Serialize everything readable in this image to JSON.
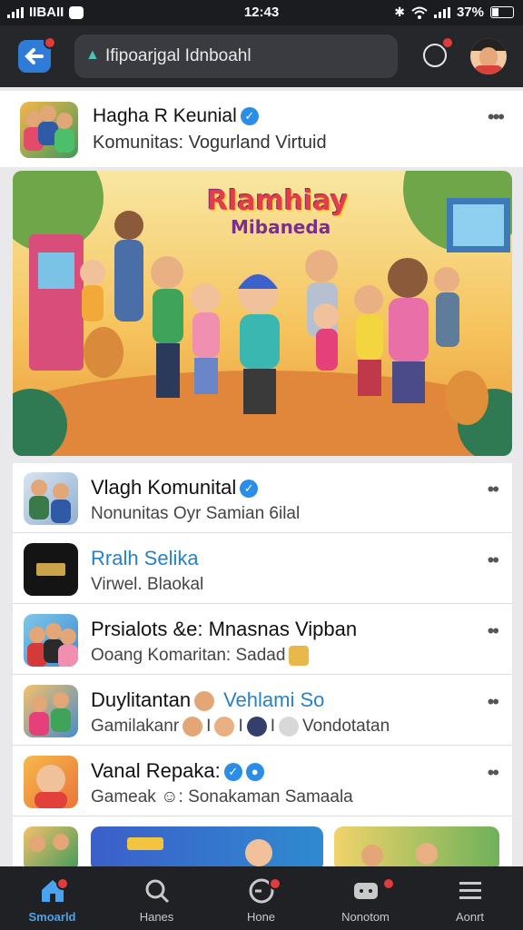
{
  "status_bar": {
    "left_text": "IIBAII",
    "time": "12:43",
    "battery": "37%"
  },
  "top_bar": {
    "search_placeholder": "Ifipoarjgal Idnboahl"
  },
  "featured": {
    "title": "Hagha R Keunial",
    "subtitle": "Komunitas: Vogurland Virtuid"
  },
  "banner": {
    "title": "Rlamhiay",
    "subtitle": "Mibaneda"
  },
  "list": [
    {
      "title": "Vlagh Komunital",
      "subtitle": "Nonunitas Oyr Samian 6ilal",
      "verified": true
    },
    {
      "title": "Rralh Selika",
      "subtitle": "Virwel. Blaokal",
      "title_color": "#2582c7"
    },
    {
      "title": "Prsialots &e: Mnasnas Vipban",
      "subtitle": "Ooang Komaritan: Sadad"
    },
    {
      "title": "Duylitantan",
      "title_tail": "Vehlami So",
      "subtitle_a": "Gamilakanr",
      "subtitle_b": "Vondotatan"
    },
    {
      "title": "Vanal Repaka:",
      "subtitle": "Gameak",
      "subtitle_b": "Sonakaman Samaala"
    }
  ],
  "tabs": [
    {
      "label": "Smoarld",
      "icon": "home-icon",
      "active": true
    },
    {
      "label": "Hanes",
      "icon": "search-icon"
    },
    {
      "label": "Hone",
      "icon": "clock-icon"
    },
    {
      "label": "Nonotom",
      "icon": "chat-icon"
    },
    {
      "label": "Aonrt",
      "icon": "menu-icon"
    }
  ],
  "colors": {
    "accent": "#2b8ee6",
    "topbar": "#26272b",
    "badge": "#e23b3b"
  }
}
